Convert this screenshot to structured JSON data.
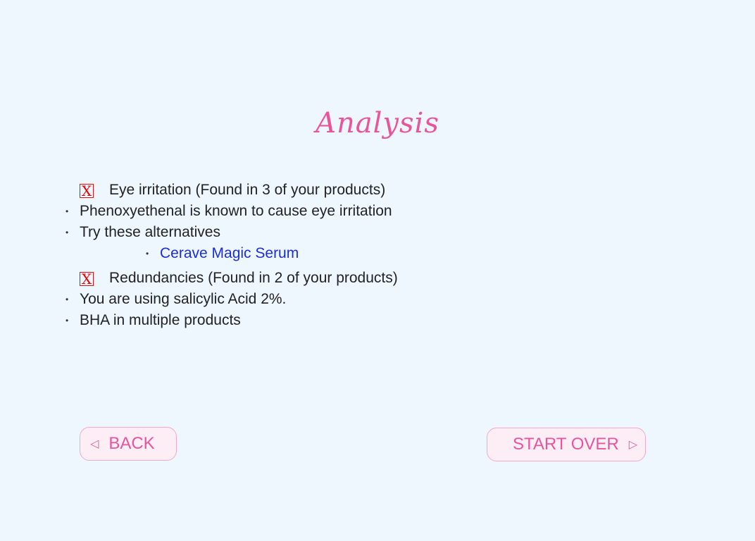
{
  "title": "Analysis",
  "issues": [
    {
      "marker": "X",
      "heading": "Eye irritation (Found in 3 of your products)",
      "points": [
        "Phenoxyethenal is known to cause eye irritation",
        "Try these alternatives"
      ],
      "alternatives": [
        "Cerave Magic Serum"
      ]
    },
    {
      "marker": "X",
      "heading": "Redundancies (Found in 2 of your products)",
      "points": [
        "You are using salicylic Acid 2%.",
        "BHA in multiple products"
      ]
    }
  ],
  "buttons": {
    "back_label": "BACK",
    "back_icon": "triangle-left-icon",
    "start_over_label": "START OVER",
    "start_over_icon": "triangle-right-icon"
  },
  "colors": {
    "background": "#eef6fe",
    "accent": "#e8559a",
    "link": "#1a2ee0",
    "error": "#e00000"
  }
}
